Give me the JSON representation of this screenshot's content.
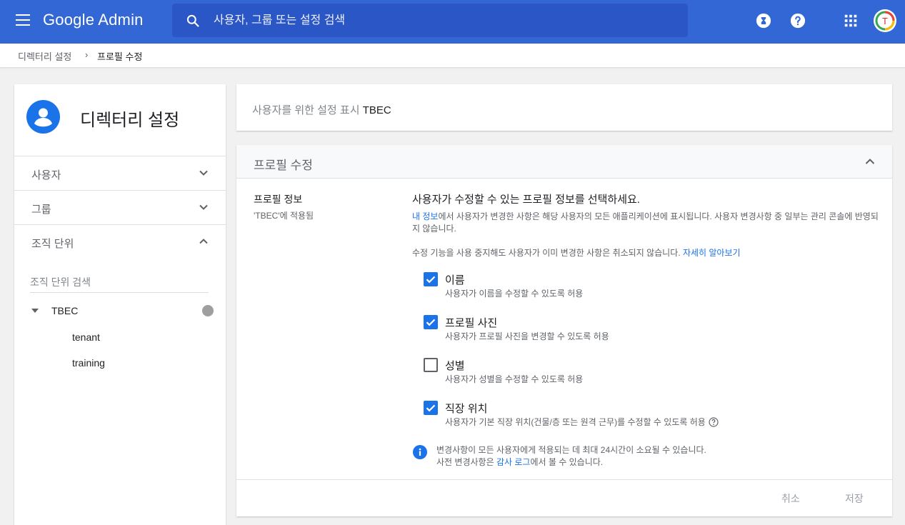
{
  "app": {
    "title": "Google Admin",
    "search_placeholder": "사용자, 그룹 또는 설정 검색",
    "avatar_letter": "T",
    "brand_color": "#3367d6",
    "accent_color": "#1a73e8",
    "icons": [
      "menu-icon",
      "search-icon",
      "hourglass-icon",
      "help-icon",
      "apps-grid-icon",
      "account-avatar"
    ]
  },
  "breadcrumb": {
    "parent": "디렉터리 설정",
    "separator": "›",
    "current": "프로필 수정"
  },
  "sidebar": {
    "title": "디렉터리 설정",
    "items": [
      {
        "label": "사용자",
        "expanded": false
      },
      {
        "label": "그룹",
        "expanded": false
      },
      {
        "label": "조직 단위",
        "expanded": true
      }
    ],
    "ou_search_placeholder": "조직 단위 검색",
    "tree": {
      "root": "TBEC",
      "children": [
        "tenant",
        "training"
      ]
    }
  },
  "header_card": {
    "prefix": "사용자를 위한 설정 표시",
    "org": "TBEC"
  },
  "section": {
    "title": "프로필 수정",
    "left_title": "프로필 정보",
    "left_sub": "'TBEC'에 적용됨",
    "question": "사용자가 수정할 수 있는 프로필 정보를 선택하세요.",
    "desc1_link": "내 정보",
    "desc1_rest": "에서 사용자가 변경한 사항은 해당 사용자의 모든 애플리케이션에 표시됩니다. 사용자 변경사항 중 일부는 관리 콘솔에 반영되지 않습니다.",
    "desc2": "수정 기능을 사용 중지해도 사용자가 이미 변경한 사항은 취소되지 않습니다.",
    "desc2_link": "자세히 알아보기",
    "options": [
      {
        "label": "이름",
        "help": "사용자가 이름을 수정할 수 있도록 허용",
        "checked": true
      },
      {
        "label": "프로필 사진",
        "help": "사용자가 프로필 사진을 변경할 수 있도록 허용",
        "checked": true
      },
      {
        "label": "성별",
        "help": "사용자가 성별을 수정할 수 있도록 허용",
        "checked": false
      },
      {
        "label": "직장 위치",
        "help": "사용자가 기본 직장 위치(건물/층 또는 원격 근무)를 수정할 수 있도록 허용",
        "checked": true
      }
    ],
    "info_line1": "변경사항이 모든 사용자에게 적용되는 데 최대 24시간이 소요될 수 있습니다.",
    "info_line2_pre": "사전 변경사항은 ",
    "info_line2_link": "감사 로그",
    "info_line2_post": "에서 볼 수 있습니다.",
    "cancel": "취소",
    "save": "저장"
  }
}
